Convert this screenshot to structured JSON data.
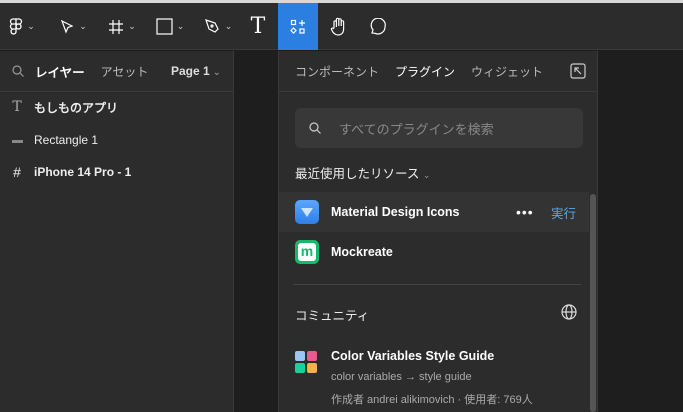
{
  "toolbar": {
    "tools": [
      "figma-menu",
      "move",
      "frame",
      "shape",
      "pen",
      "text",
      "resources",
      "hand",
      "comment"
    ],
    "active": "resources"
  },
  "layers_panel": {
    "tab_layers": "レイヤー",
    "tab_assets": "アセット",
    "page": "Page 1",
    "layers": [
      {
        "icon": "text-icon",
        "name": "もしものアプリ"
      },
      {
        "icon": "rectangle-icon",
        "name": "Rectangle 1"
      },
      {
        "icon": "frame-icon",
        "name": "iPhone 14 Pro - 1"
      }
    ]
  },
  "resources": {
    "tabs": [
      "コンポーネント",
      "プラグイン",
      "ウィジェット"
    ],
    "search_placeholder": "すべてのプラグインを検索",
    "recent_label": "最近使用したリソース",
    "recent": [
      {
        "name": "Material Design Icons",
        "action": "実行"
      },
      {
        "name": "Mockreate"
      }
    ],
    "community_label": "コミュニティ",
    "community": [
      {
        "name": "Color Variables Style Guide",
        "desc": "color variables → style guide",
        "meta": "作成者 andrei alikimovich · 使用者: 769人"
      }
    ]
  },
  "colors": {
    "accent": "#2a7fe0",
    "run": "#5aa7ee"
  }
}
